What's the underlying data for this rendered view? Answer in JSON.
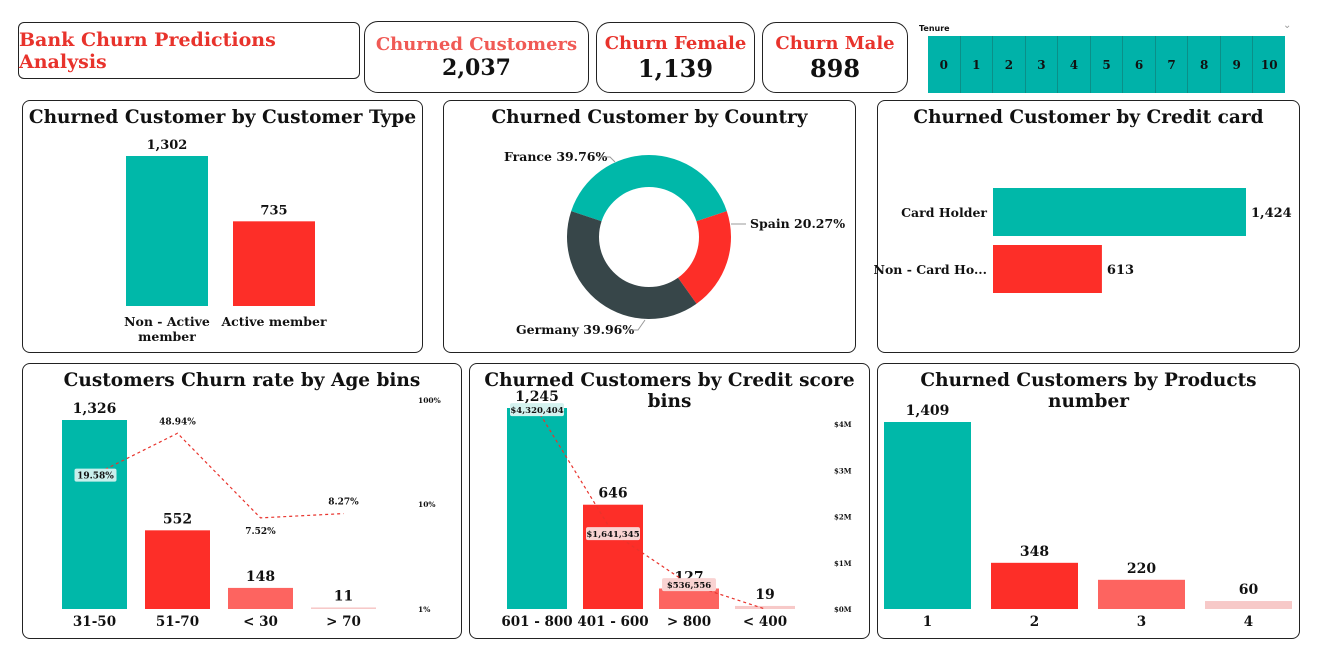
{
  "header": {
    "title": "Bank Churn Predictions Analysis",
    "kpis": [
      {
        "label": "Churned Customers",
        "value": "2,037",
        "color": "#f05a55"
      },
      {
        "label": "Churn Female",
        "value": "1,139",
        "color": "#e8332c"
      },
      {
        "label": "Churn Male",
        "value": "898",
        "color": "#e8332c"
      }
    ],
    "tenure": {
      "label": "Tenure",
      "options": [
        "0",
        "1",
        "2",
        "3",
        "4",
        "5",
        "6",
        "7",
        "8",
        "9",
        "10"
      ]
    }
  },
  "colors": {
    "teal": "#00b8a9",
    "red": "#fd2e28",
    "salmon": "#fd6460",
    "pink": "#f7c9c8",
    "dark": "#374649",
    "accent": "#e8332c"
  },
  "chart_data": [
    {
      "id": "customer_type",
      "type": "bar",
      "title": "Churned Customer by Customer Type",
      "categories": [
        "Non - Active member",
        "Active member"
      ],
      "values": [
        1302,
        735
      ],
      "value_labels": [
        "1,302",
        "735"
      ],
      "ylim": [
        0,
        1302
      ]
    },
    {
      "id": "country",
      "type": "pie",
      "title": "Churned Customer by Country",
      "labels": [
        "France",
        "Spain",
        "Germany"
      ],
      "values": [
        39.76,
        20.27,
        39.96
      ],
      "value_labels": [
        "France 39.76%",
        "Spain 20.27%",
        "Germany 39.96%"
      ]
    },
    {
      "id": "credit_card",
      "type": "bar",
      "orientation": "horizontal",
      "title": "Churned Customer by Credit card",
      "categories": [
        "Card Holder",
        "Non - Card Ho..."
      ],
      "values": [
        1424,
        613
      ],
      "value_labels": [
        "1,424",
        "613"
      ]
    },
    {
      "id": "age_bins",
      "type": "bar",
      "title": "Customers Churn rate by Age bins",
      "categories": [
        "31-50",
        "51-70",
        "< 30",
        "> 70"
      ],
      "values": [
        1326,
        552,
        148,
        11
      ],
      "value_labels": [
        "1,326",
        "552",
        "148",
        "11"
      ],
      "line_series": {
        "values": [
          19.58,
          48.94,
          7.52,
          8.27
        ],
        "labels": [
          "19.58%",
          "48.94%",
          "7.52%",
          "8.27%"
        ],
        "scale": "log"
      },
      "secondary_axis_ticks": [
        "100%",
        "10%",
        "1%"
      ]
    },
    {
      "id": "credit_score_bins",
      "type": "bar",
      "title": "Churned Customers by Credit score bins",
      "categories": [
        "601 - 800",
        "401 - 600",
        "> 800",
        "< 400"
      ],
      "values": [
        1245,
        646,
        127,
        19
      ],
      "value_labels": [
        "1,245",
        "646",
        "127",
        "19"
      ],
      "line_series": {
        "values": [
          4320404,
          1641345,
          536556,
          0
        ],
        "labels": [
          "$4,320,404",
          "$1,641,345",
          "$536,556",
          ""
        ]
      },
      "secondary_axis_ticks": [
        "$4M",
        "$3M",
        "$2M",
        "$1M",
        "$0M"
      ]
    },
    {
      "id": "products_number",
      "type": "bar",
      "title": "Churned Customers by Products number",
      "categories": [
        "1",
        "2",
        "3",
        "4"
      ],
      "values": [
        1409,
        348,
        220,
        60
      ],
      "value_labels": [
        "1,409",
        "348",
        "220",
        "60"
      ]
    }
  ]
}
